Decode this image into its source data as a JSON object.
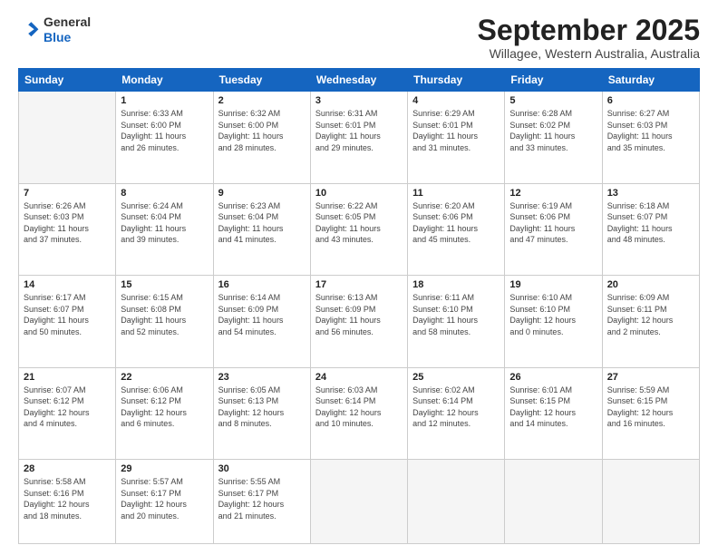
{
  "header": {
    "logo_line1": "General",
    "logo_line2": "Blue",
    "month_title": "September 2025",
    "subtitle": "Willagee, Western Australia, Australia"
  },
  "days_of_week": [
    "Sunday",
    "Monday",
    "Tuesday",
    "Wednesday",
    "Thursday",
    "Friday",
    "Saturday"
  ],
  "weeks": [
    [
      {
        "num": "",
        "info": ""
      },
      {
        "num": "1",
        "info": "Sunrise: 6:33 AM\nSunset: 6:00 PM\nDaylight: 11 hours\nand 26 minutes."
      },
      {
        "num": "2",
        "info": "Sunrise: 6:32 AM\nSunset: 6:00 PM\nDaylight: 11 hours\nand 28 minutes."
      },
      {
        "num": "3",
        "info": "Sunrise: 6:31 AM\nSunset: 6:01 PM\nDaylight: 11 hours\nand 29 minutes."
      },
      {
        "num": "4",
        "info": "Sunrise: 6:29 AM\nSunset: 6:01 PM\nDaylight: 11 hours\nand 31 minutes."
      },
      {
        "num": "5",
        "info": "Sunrise: 6:28 AM\nSunset: 6:02 PM\nDaylight: 11 hours\nand 33 minutes."
      },
      {
        "num": "6",
        "info": "Sunrise: 6:27 AM\nSunset: 6:03 PM\nDaylight: 11 hours\nand 35 minutes."
      }
    ],
    [
      {
        "num": "7",
        "info": "Sunrise: 6:26 AM\nSunset: 6:03 PM\nDaylight: 11 hours\nand 37 minutes."
      },
      {
        "num": "8",
        "info": "Sunrise: 6:24 AM\nSunset: 6:04 PM\nDaylight: 11 hours\nand 39 minutes."
      },
      {
        "num": "9",
        "info": "Sunrise: 6:23 AM\nSunset: 6:04 PM\nDaylight: 11 hours\nand 41 minutes."
      },
      {
        "num": "10",
        "info": "Sunrise: 6:22 AM\nSunset: 6:05 PM\nDaylight: 11 hours\nand 43 minutes."
      },
      {
        "num": "11",
        "info": "Sunrise: 6:20 AM\nSunset: 6:06 PM\nDaylight: 11 hours\nand 45 minutes."
      },
      {
        "num": "12",
        "info": "Sunrise: 6:19 AM\nSunset: 6:06 PM\nDaylight: 11 hours\nand 47 minutes."
      },
      {
        "num": "13",
        "info": "Sunrise: 6:18 AM\nSunset: 6:07 PM\nDaylight: 11 hours\nand 48 minutes."
      }
    ],
    [
      {
        "num": "14",
        "info": "Sunrise: 6:17 AM\nSunset: 6:07 PM\nDaylight: 11 hours\nand 50 minutes."
      },
      {
        "num": "15",
        "info": "Sunrise: 6:15 AM\nSunset: 6:08 PM\nDaylight: 11 hours\nand 52 minutes."
      },
      {
        "num": "16",
        "info": "Sunrise: 6:14 AM\nSunset: 6:09 PM\nDaylight: 11 hours\nand 54 minutes."
      },
      {
        "num": "17",
        "info": "Sunrise: 6:13 AM\nSunset: 6:09 PM\nDaylight: 11 hours\nand 56 minutes."
      },
      {
        "num": "18",
        "info": "Sunrise: 6:11 AM\nSunset: 6:10 PM\nDaylight: 11 hours\nand 58 minutes."
      },
      {
        "num": "19",
        "info": "Sunrise: 6:10 AM\nSunset: 6:10 PM\nDaylight: 12 hours\nand 0 minutes."
      },
      {
        "num": "20",
        "info": "Sunrise: 6:09 AM\nSunset: 6:11 PM\nDaylight: 12 hours\nand 2 minutes."
      }
    ],
    [
      {
        "num": "21",
        "info": "Sunrise: 6:07 AM\nSunset: 6:12 PM\nDaylight: 12 hours\nand 4 minutes."
      },
      {
        "num": "22",
        "info": "Sunrise: 6:06 AM\nSunset: 6:12 PM\nDaylight: 12 hours\nand 6 minutes."
      },
      {
        "num": "23",
        "info": "Sunrise: 6:05 AM\nSunset: 6:13 PM\nDaylight: 12 hours\nand 8 minutes."
      },
      {
        "num": "24",
        "info": "Sunrise: 6:03 AM\nSunset: 6:14 PM\nDaylight: 12 hours\nand 10 minutes."
      },
      {
        "num": "25",
        "info": "Sunrise: 6:02 AM\nSunset: 6:14 PM\nDaylight: 12 hours\nand 12 minutes."
      },
      {
        "num": "26",
        "info": "Sunrise: 6:01 AM\nSunset: 6:15 PM\nDaylight: 12 hours\nand 14 minutes."
      },
      {
        "num": "27",
        "info": "Sunrise: 5:59 AM\nSunset: 6:15 PM\nDaylight: 12 hours\nand 16 minutes."
      }
    ],
    [
      {
        "num": "28",
        "info": "Sunrise: 5:58 AM\nSunset: 6:16 PM\nDaylight: 12 hours\nand 18 minutes."
      },
      {
        "num": "29",
        "info": "Sunrise: 5:57 AM\nSunset: 6:17 PM\nDaylight: 12 hours\nand 20 minutes."
      },
      {
        "num": "30",
        "info": "Sunrise: 5:55 AM\nSunset: 6:17 PM\nDaylight: 12 hours\nand 21 minutes."
      },
      {
        "num": "",
        "info": ""
      },
      {
        "num": "",
        "info": ""
      },
      {
        "num": "",
        "info": ""
      },
      {
        "num": "",
        "info": ""
      }
    ]
  ]
}
